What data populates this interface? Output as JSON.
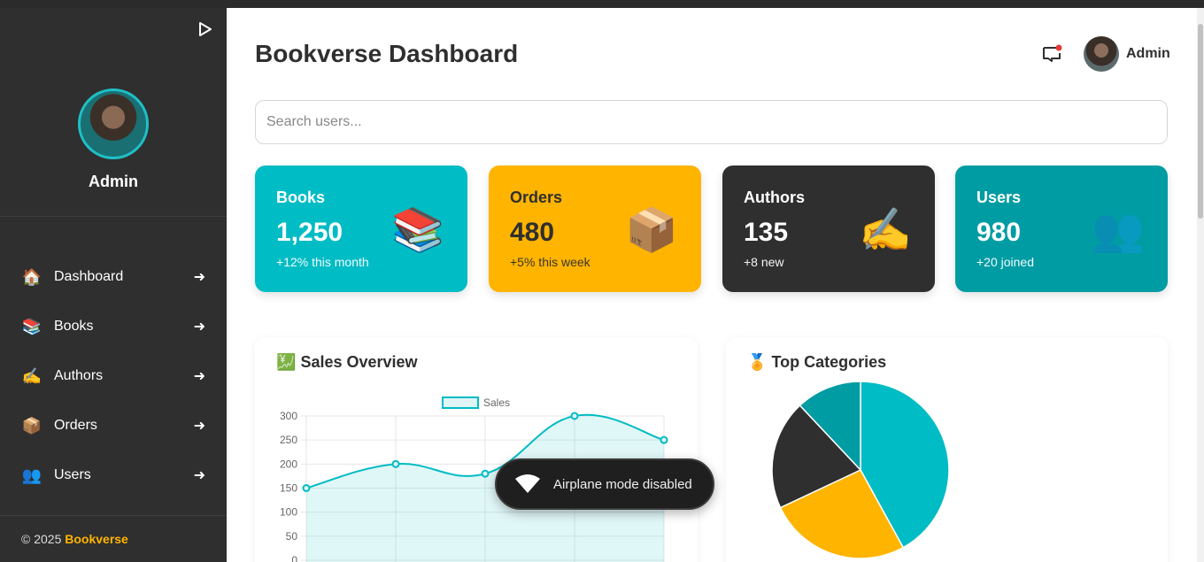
{
  "sidebar": {
    "user_name": "Admin",
    "items": [
      {
        "icon": "🏠",
        "icon_name": "house-icon",
        "label": "Dashboard",
        "arrow": "➜"
      },
      {
        "icon": "📚",
        "icon_name": "books-icon",
        "label": "Books",
        "arrow": "➜"
      },
      {
        "icon": "✍️",
        "icon_name": "writing-hand-icon",
        "label": "Authors",
        "arrow": "➜"
      },
      {
        "icon": "📦",
        "icon_name": "package-icon",
        "label": "Orders",
        "arrow": "➜"
      },
      {
        "icon": "👥",
        "icon_name": "users-icon",
        "label": "Users",
        "arrow": "➜"
      }
    ],
    "footer_prefix": "© 2025 ",
    "footer_brand": "Bookverse"
  },
  "header": {
    "title": "Bookverse Dashboard",
    "user_name": "Admin"
  },
  "search": {
    "placeholder": "Search users...",
    "value": ""
  },
  "cards": [
    {
      "title": "Books",
      "value": "1,250",
      "sub": "+12% this month",
      "icon": "📚",
      "color": "#00bcc4"
    },
    {
      "title": "Orders",
      "value": "480",
      "sub": "+5% this week",
      "icon": "📦",
      "color": "#ffb400"
    },
    {
      "title": "Authors",
      "value": "135",
      "sub": "+8 new",
      "icon": "✍️",
      "color": "#2f2f2f"
    },
    {
      "title": "Users",
      "value": "980",
      "sub": "+20 joined",
      "icon": "👥",
      "color": "#009ca3"
    }
  ],
  "panels": {
    "sales_title": "Sales Overview",
    "sales_icon": "💹",
    "categories_title": "Top Categories",
    "categories_icon": "🏅"
  },
  "toast": {
    "message": "Airplane mode disabled"
  },
  "colors": {
    "accent": "#00bcc4",
    "yellow": "#ffb400",
    "dark": "#2f2f2f",
    "teal": "#009ca3"
  },
  "chart_data": [
    {
      "type": "line",
      "legend": [
        "Sales"
      ],
      "x": [
        "",
        "",
        "",
        "",
        ""
      ],
      "series": [
        {
          "name": "Sales",
          "values": [
            150,
            200,
            180,
            300,
            250
          ]
        }
      ],
      "ylim": [
        0,
        300
      ],
      "yticks": [
        0,
        50,
        100,
        150,
        200,
        250,
        300
      ],
      "grid": true,
      "fill": true,
      "legend_position": "top"
    },
    {
      "type": "pie",
      "values": [
        42,
        26,
        20,
        12
      ],
      "colors": [
        "#00bcc4",
        "#ffb400",
        "#2f2f2f",
        "#009ca3"
      ]
    }
  ]
}
